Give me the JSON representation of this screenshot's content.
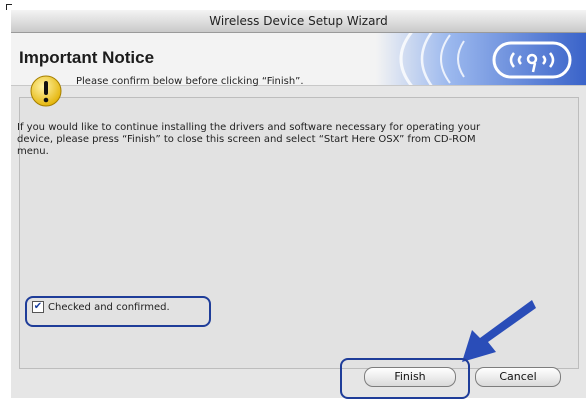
{
  "window": {
    "title": "Wireless Device Setup Wizard"
  },
  "banner": {
    "title": "Important Notice",
    "logo_icon": "wireless-signal-icon"
  },
  "notice": {
    "icon": "warning-icon",
    "text": "Please confirm below before clicking “Finish”."
  },
  "body": {
    "lines": [
      "If you would like to continue installing the drivers and software necessary for operating your",
      "device, please press “Finish” to close this screen and select “Start Here OSX” from CD-ROM",
      "menu."
    ]
  },
  "confirm": {
    "label": "Checked and confirmed.",
    "checked": true
  },
  "buttons": {
    "finish": "Finish",
    "cancel": "Cancel"
  },
  "colors": {
    "highlight": "#1f3d99",
    "arrow": "#2a4db8",
    "banner_blue": "#3f6fd6"
  }
}
